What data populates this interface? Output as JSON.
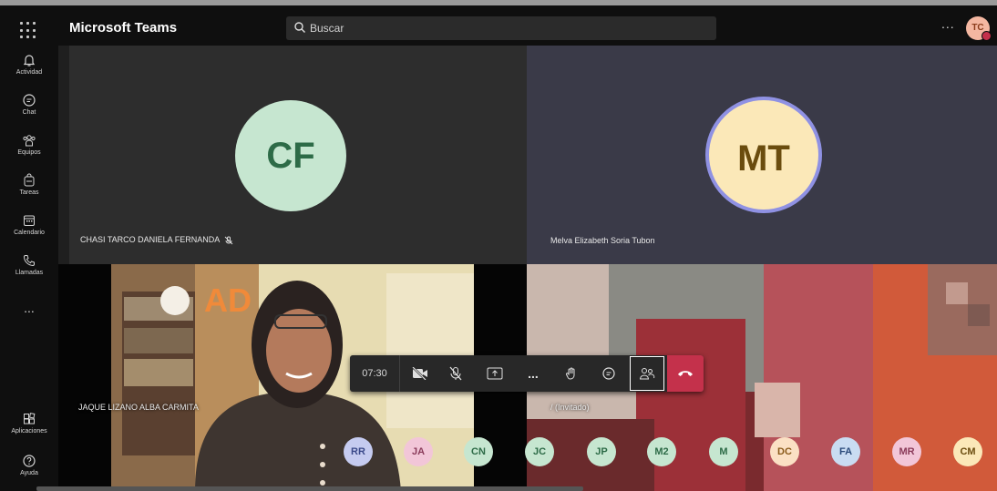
{
  "app": {
    "title": "Microsoft Teams"
  },
  "search": {
    "placeholder": "Buscar"
  },
  "user": {
    "initials": "TC",
    "status_color": "#c4314b"
  },
  "sidebar": {
    "items": [
      {
        "label": "Actividad",
        "icon": "bell-icon"
      },
      {
        "label": "Chat",
        "icon": "chat-icon"
      },
      {
        "label": "Equipos",
        "icon": "teams-icon"
      },
      {
        "label": "Tareas",
        "icon": "tasks-icon"
      },
      {
        "label": "Calendario",
        "icon": "calendar-icon"
      },
      {
        "label": "Llamadas",
        "icon": "phone-icon"
      }
    ],
    "more": "...",
    "bottom": [
      {
        "label": "Aplicaciones",
        "icon": "apps-icon"
      },
      {
        "label": "Ayuda",
        "icon": "help-icon"
      }
    ]
  },
  "tiles": [
    {
      "initials": "CF",
      "name": "CHASI TARCO DANIELA FERNANDA",
      "muted": true,
      "color": "#c6e6d0"
    },
    {
      "initials": "MT",
      "name": "Melva Elizabeth Soria Tubon",
      "speaking": true,
      "color": "#fbe8b8"
    },
    {
      "name": "JAQUE LIZANO ALBA CARMITA",
      "video": true
    },
    {
      "name": "/ (Invitado)",
      "video": true
    }
  ],
  "toolbar": {
    "time": "07:30",
    "buttons": [
      "camera-off-icon",
      "mic-off-icon",
      "share-icon",
      "more-icon",
      "raise-hand-icon",
      "chat-icon",
      "participants-icon",
      "hang-up-icon"
    ]
  },
  "participants": [
    {
      "initials": "RR",
      "color": "#c5cbf0"
    },
    {
      "initials": "JA",
      "color": "#f2c6d8"
    },
    {
      "initials": "CN",
      "color": "#c6e6d0"
    },
    {
      "initials": "JC",
      "color": "#c6e6d0"
    },
    {
      "initials": "JP",
      "color": "#c6e6d0"
    },
    {
      "initials": "M2",
      "color": "#c6e6d0"
    },
    {
      "initials": "M",
      "color": "#c6e6d0"
    },
    {
      "initials": "DC",
      "color": "#fbe0c4"
    },
    {
      "initials": "FA",
      "color": "#c9dcf2"
    },
    {
      "initials": "MR",
      "color": "#f2c6d8"
    },
    {
      "initials": "CM",
      "color": "#fbe8b8"
    }
  ]
}
